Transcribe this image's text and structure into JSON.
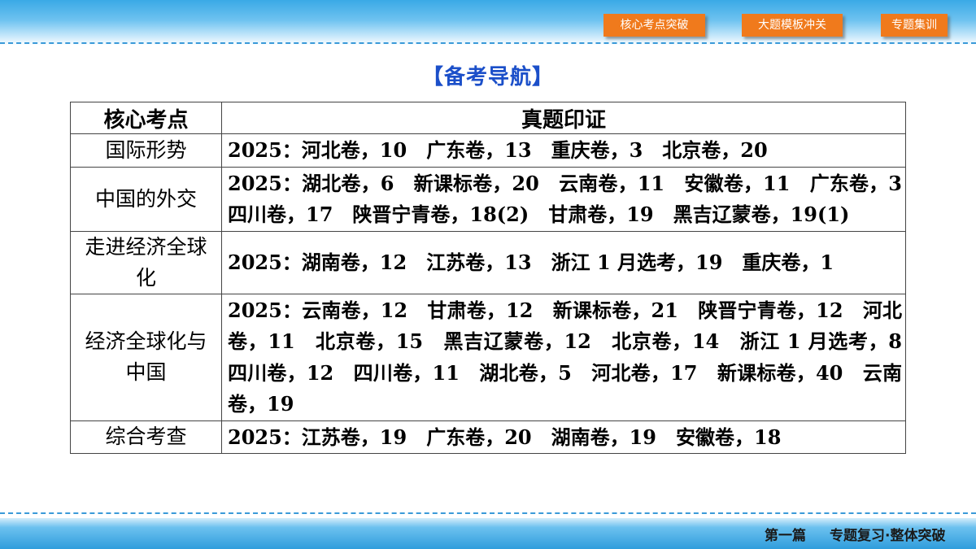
{
  "nav": {
    "buttons": [
      "核心考点突破",
      "大题模板冲关",
      "专题集训"
    ]
  },
  "title": "【备考导航】",
  "table": {
    "headers": [
      "核心考点",
      "真题印证"
    ],
    "rows": [
      {
        "topic": "国际形势",
        "evidence": "2025：河北卷，10　广东卷，13　重庆卷，3　北京卷，20"
      },
      {
        "topic": "中国的外交",
        "evidence": "2025：湖北卷，6　新课标卷，20　云南卷，11　安徽卷，11　广东卷，3　四川卷，17　陕晋宁青卷，18(2)　甘肃卷，19　黑吉辽蒙卷，19(1)"
      },
      {
        "topic": "走进经济全球化",
        "evidence": "2025：湖南卷，12　江苏卷，13　浙江 1 月选考，19　重庆卷，1"
      },
      {
        "topic": "经济全球化与中国",
        "evidence": "2025：云南卷，12　甘肃卷，12　新课标卷，21　陕晋宁青卷，12　河北卷，11　北京卷，15　黑吉辽蒙卷，12　北京卷，14　浙江 1 月选考，8　四川卷，12　四川卷，11　湖北卷，5　河北卷，17　新课标卷，40　云南卷，19"
      },
      {
        "topic": "综合考查",
        "evidence": "2025：江苏卷，19　广东卷，20　湖南卷，19　安徽卷，18"
      }
    ]
  },
  "footer": {
    "part": "第一篇",
    "chapter": "专题复习·整体突破"
  },
  "colors": {
    "accent_orange": "#f07a1c",
    "title_blue": "#1b4fc9",
    "banner_blue": "#3aa9e6"
  }
}
